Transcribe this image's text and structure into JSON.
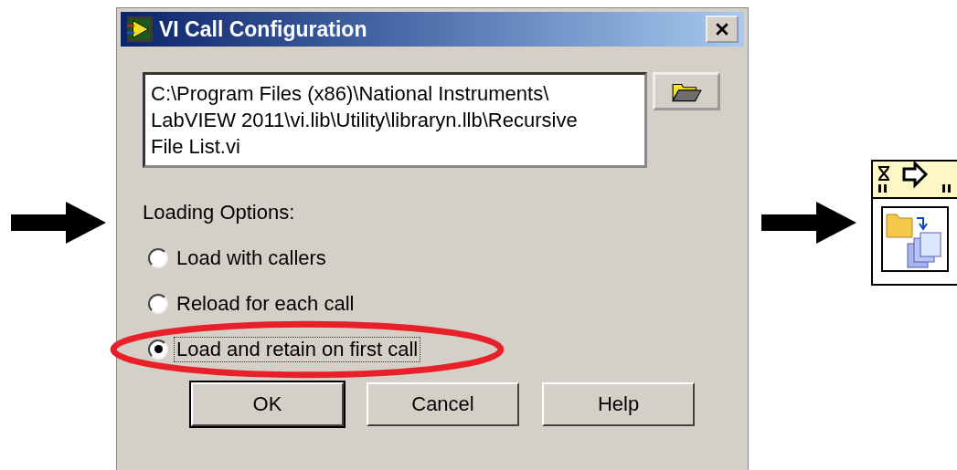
{
  "window": {
    "title": "VI Call Configuration"
  },
  "path_field": {
    "value": "C:\\Program Files (x86)\\National Instruments\\\nLabVIEW 2011\\vi.lib\\Utility\\libraryn.llb\\Recursive\nFile List.vi"
  },
  "loading_options": {
    "label": "Loading Options:",
    "options": [
      {
        "label": "Load with callers",
        "selected": false,
        "focused": false,
        "highlighted": false
      },
      {
        "label": "Reload for each call",
        "selected": false,
        "focused": false,
        "highlighted": false
      },
      {
        "label": "Load and retain on first call",
        "selected": true,
        "focused": true,
        "highlighted": true
      }
    ]
  },
  "buttons": [
    {
      "label": "OK",
      "default": true
    },
    {
      "label": "Cancel",
      "default": false
    },
    {
      "label": "Help",
      "default": false
    }
  ]
}
